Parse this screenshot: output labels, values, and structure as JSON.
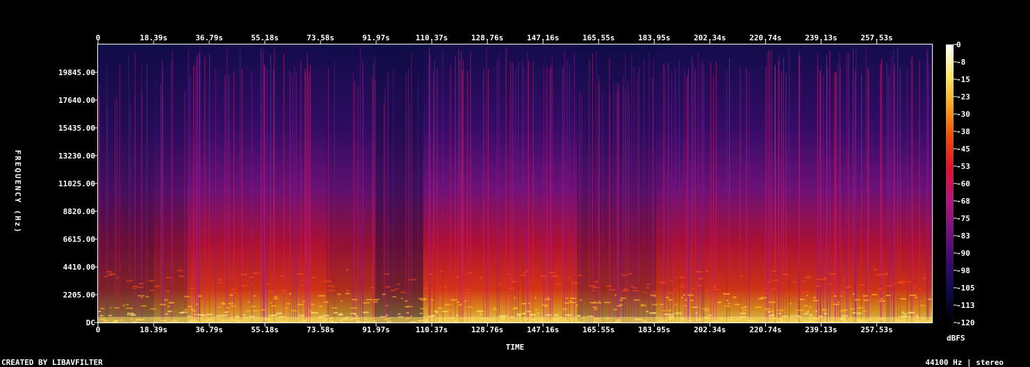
{
  "chart_data": {
    "type": "heatmap",
    "xlabel": "TIME",
    "ylabel": "FREQUENCY (Hz)",
    "x_ticks": [
      "0",
      "18.39s",
      "36.79s",
      "55.18s",
      "73.58s",
      "91.97s",
      "110.37s",
      "128.76s",
      "147.16s",
      "165.55s",
      "183.95s",
      "202.34s",
      "220.74s",
      "239.13s",
      "257.53s"
    ],
    "x_tick_values": [
      0,
      18.39,
      36.79,
      55.18,
      73.58,
      91.97,
      110.37,
      128.76,
      147.16,
      165.55,
      183.95,
      202.34,
      220.74,
      239.13,
      257.53
    ],
    "xlim": [
      0,
      275.8
    ],
    "y_ticks": [
      "DC",
      "2205.00",
      "4410.00",
      "6615.00",
      "8820.00",
      "11025.00",
      "13230.00",
      "15435.00",
      "17640.00",
      "19845.00"
    ],
    "y_tick_values": [
      0,
      2205,
      4410,
      6615,
      8820,
      11025,
      13230,
      15435,
      17640,
      19845
    ],
    "ylim": [
      0,
      22050
    ],
    "colorbar": {
      "label": "dBFS",
      "ticks": [
        "0",
        "-8",
        "-15",
        "-23",
        "-30",
        "-38",
        "-45",
        "-53",
        "-60",
        "-68",
        "-75",
        "-83",
        "-90",
        "-98",
        "-105",
        "-113",
        "-120"
      ],
      "range": [
        -120,
        0
      ],
      "stops": [
        "#000000",
        "#0c0b4a",
        "#3a0b6e",
        "#7a1282",
        "#b5167a",
        "#e0112f",
        "#f34a0a",
        "#fba41a",
        "#ffe66a",
        "#ffffff"
      ]
    },
    "segments": [
      {
        "start": 0,
        "end": 18.4,
        "level": 0.5
      },
      {
        "start": 18.4,
        "end": 29.5,
        "level": 0.62
      },
      {
        "start": 29.5,
        "end": 75.5,
        "level": 0.85
      },
      {
        "start": 75.5,
        "end": 91.5,
        "level": 0.72
      },
      {
        "start": 91.5,
        "end": 107.5,
        "level": 0.45
      },
      {
        "start": 107.5,
        "end": 158.5,
        "level": 0.88
      },
      {
        "start": 158.5,
        "end": 184.5,
        "level": 0.62
      },
      {
        "start": 184.5,
        "end": 189.5,
        "level": 0.8
      },
      {
        "start": 189.5,
        "end": 275.8,
        "level": 0.85
      }
    ]
  },
  "footer": {
    "credit": "CREATED BY LIBAVFILTER",
    "info": "44100 Hz | stereo"
  }
}
